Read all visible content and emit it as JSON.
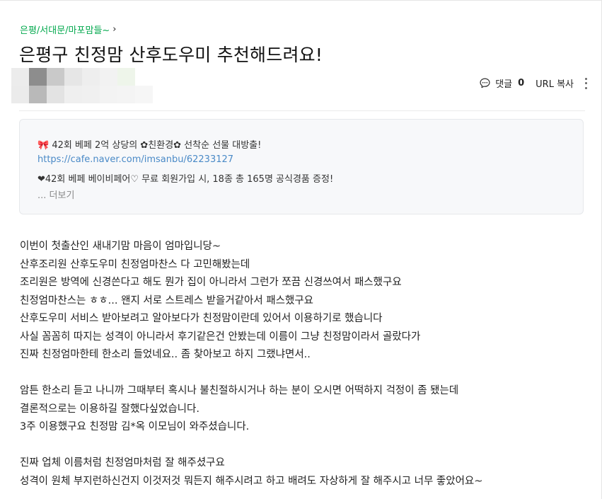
{
  "breadcrumb": {
    "label": "은평/서대문/마포맘들~",
    "chevron": "›"
  },
  "post": {
    "title": "은평구 친정맘 산후도우미 추천해드려요!"
  },
  "meta": {
    "comment_label": "댓글",
    "comment_count": "0",
    "url_copy_label": "URL 복사"
  },
  "notice": {
    "line1": "🎀 42회 베페 2억 상당의 ✿친환경✿ 선착순 선물 대방출!",
    "link": "https://cafe.naver.com/imsanbu/62233127",
    "line3": "❤42회 베페 베이비페어♡ 무료 회원가입 시, 18종 총 165명 공식경품 증정!",
    "more": "... 더보기"
  },
  "content": [
    "이번이 첫출산인 새내기맘 마음이 엄마입니당~",
    "산후조리원 산후도우미 친정엄마찬스 다 고민해봤는데",
    "조리원은 방역에 신경쓴다고 해도 뭔가 집이 아니라서 그런가 쪼끔 신경쓰여서 패스했구요",
    "친정엄마찬스는 ㅎㅎ... 왠지 서로 스트레스 받을거같아서 패스했구요",
    "산후도우미 서비스 받아보려고 알아보다가 친정맘이란데 있어서 이용하기로 했습니다",
    "사실 꼼꼼히 따지는 성격이 아니라서 후기같은건 안봤는데 이름이 그냥 친정맘이라서 골랐다가",
    "진짜 친정엄마한테 한소리 들었네요.. 좀 찾아보고 하지 그랬냐면서..",
    "",
    "암튼 한소리 듣고 나니까 그때부터 혹시나 불친절하시거나 하는 분이 오시면 어떡하지 걱정이 좀 됐는데",
    "결론적으로는 이용하길 잘했다싶었습니다.",
    "3주 이용했구요 친정맘 김*옥 이모님이 와주셨습니다.",
    "",
    "진짜 업체 이름처럼 친정엄마처럼 잘 해주셨구요",
    "성격이 원체 부지런하신건지 이것저것 뭐든지 해주시려고 하고 배려도 자상하게 잘 해주시고 너무 좋았어요~"
  ],
  "colors": {
    "breadcrumb": "#03a94e",
    "link": "#4a8ac7"
  }
}
